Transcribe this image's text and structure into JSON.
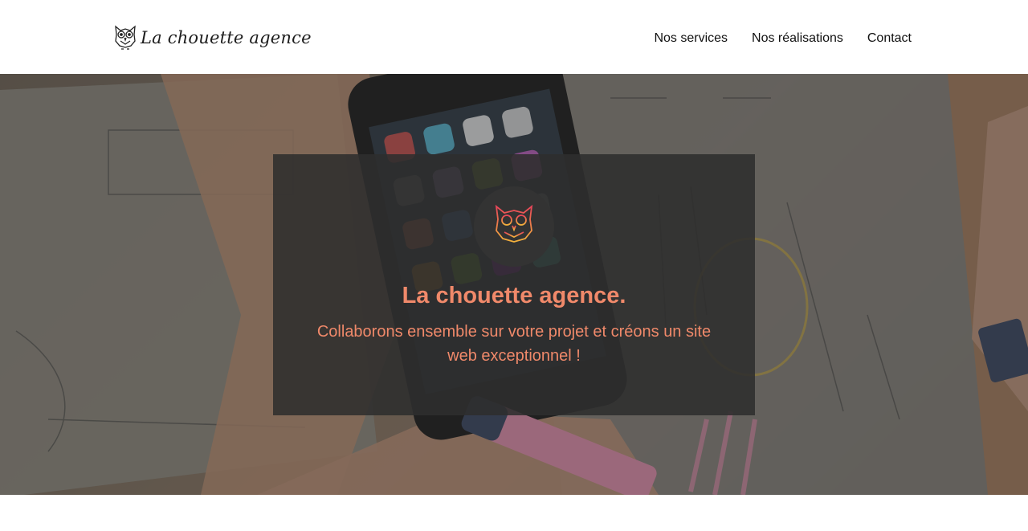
{
  "header": {
    "logo_text": "La chouette agence",
    "nav": [
      {
        "label": "Nos services"
      },
      {
        "label": "Nos réalisations"
      },
      {
        "label": "Contact"
      }
    ]
  },
  "hero": {
    "title": "La chouette agence.",
    "subtitle": "Collaborons ensemble sur votre projet et créons un site web exceptionnel !",
    "accent_color": "#f0896a",
    "badge_icon": "owl-icon"
  }
}
